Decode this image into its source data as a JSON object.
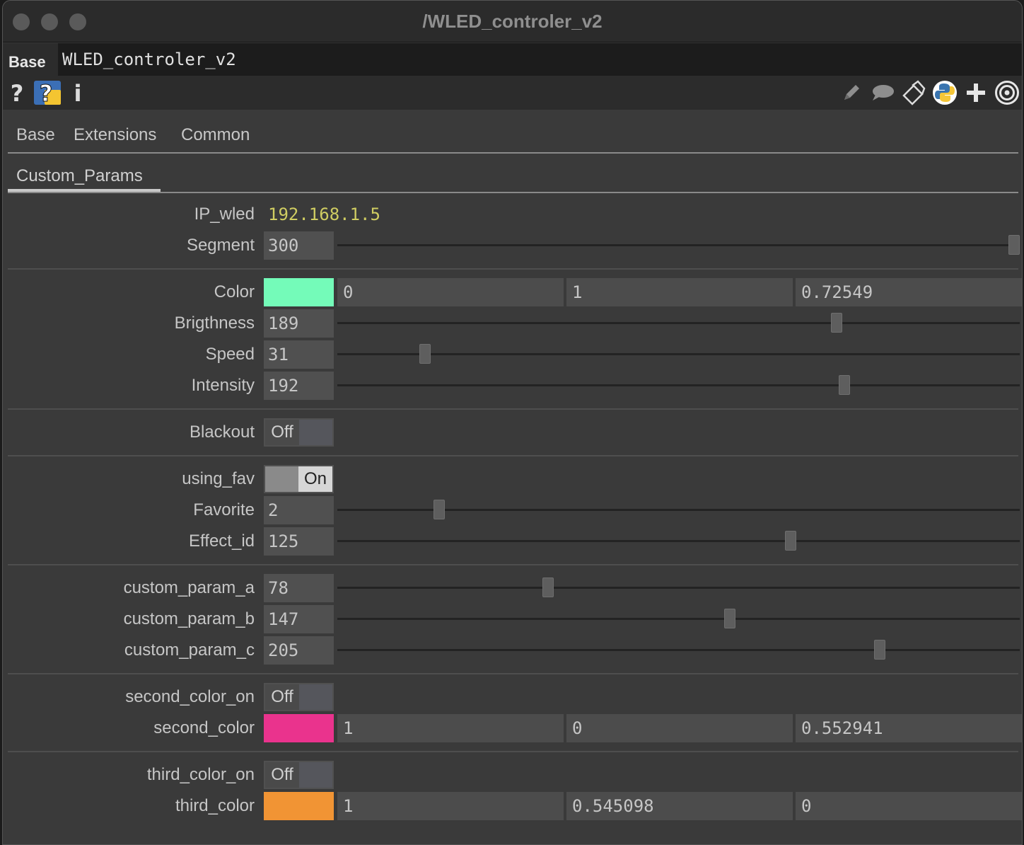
{
  "window": {
    "title": "/WLED_controler_v2"
  },
  "namebar": {
    "type_label": "Base",
    "name": "WLED_controler_v2"
  },
  "icons": {
    "left": [
      "help-icon",
      "python-help-icon",
      "info-icon"
    ],
    "right": [
      "pencil-icon",
      "comment-icon",
      "clone-icon",
      "python-icon",
      "add-icon",
      "target-icon"
    ]
  },
  "tabs": [
    "Base",
    "Extensions",
    "Common"
  ],
  "subtab": "Custom_Params",
  "params": {
    "ip_wled": {
      "label": "IP_wled",
      "value": "192.168.1.5"
    },
    "segment": {
      "label": "Segment",
      "value": "300",
      "fraction": 1.0
    },
    "color": {
      "label": "Color",
      "swatch": "#74fbb9",
      "r": "0",
      "g": "1",
      "b": "0.72549"
    },
    "brightness": {
      "label": "Brigthness",
      "value": "189",
      "fraction": 0.735
    },
    "speed": {
      "label": "Speed",
      "value": "31",
      "fraction": 0.122
    },
    "intensity": {
      "label": "Intensity",
      "value": "192",
      "fraction": 0.747
    },
    "blackout": {
      "label": "Blackout",
      "state": "Off"
    },
    "using_fav": {
      "label": "using_fav",
      "state": "On"
    },
    "favorite": {
      "label": "Favorite",
      "value": "2",
      "fraction": 0.143
    },
    "effect_id": {
      "label": "Effect_id",
      "value": "125",
      "fraction": 0.667
    },
    "custom_param_a": {
      "label": "custom_param_a",
      "value": "78",
      "fraction": 0.306
    },
    "custom_param_b": {
      "label": "custom_param_b",
      "value": "147",
      "fraction": 0.576
    },
    "custom_param_c": {
      "label": "custom_param_c",
      "value": "205",
      "fraction": 0.8
    },
    "second_color_on": {
      "label": "second_color_on",
      "state": "Off"
    },
    "second_color": {
      "label": "second_color",
      "swatch": "#ea338d",
      "r": "1",
      "g": "0",
      "b": "0.552941"
    },
    "third_color_on": {
      "label": "third_color_on",
      "state": "Off"
    },
    "third_color": {
      "label": "third_color",
      "swatch": "#f19434",
      "r": "1",
      "g": "0.545098",
      "b": "0"
    }
  }
}
